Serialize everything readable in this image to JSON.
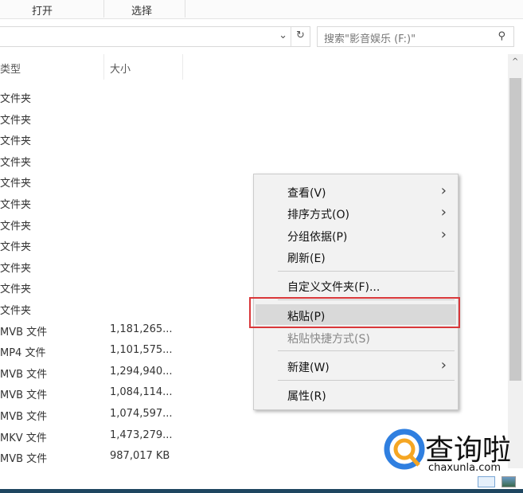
{
  "ribbon": {
    "tabs": [
      "打开",
      "选择"
    ]
  },
  "search": {
    "placeholder": "搜索\"影音娱乐 (F:)\""
  },
  "columns": {
    "type": "类型",
    "size": "大小"
  },
  "rows": [
    {
      "type": "文件夹",
      "size": ""
    },
    {
      "type": "文件夹",
      "size": ""
    },
    {
      "type": "文件夹",
      "size": ""
    },
    {
      "type": "文件夹",
      "size": ""
    },
    {
      "type": "文件夹",
      "size": ""
    },
    {
      "type": "文件夹",
      "size": ""
    },
    {
      "type": "文件夹",
      "size": ""
    },
    {
      "type": "文件夹",
      "size": ""
    },
    {
      "type": "文件夹",
      "size": ""
    },
    {
      "type": "文件夹",
      "size": ""
    },
    {
      "type": "文件夹",
      "size": ""
    },
    {
      "type": "MVB 文件",
      "size": "1,181,265..."
    },
    {
      "type": "MP4 文件",
      "size": "1,101,575..."
    },
    {
      "type": "MVB 文件",
      "size": "1,294,940..."
    },
    {
      "type": "MVB 文件",
      "size": "1,084,114..."
    },
    {
      "type": "MVB 文件",
      "size": "1,074,597..."
    },
    {
      "type": "MKV 文件",
      "size": "1,473,279..."
    },
    {
      "type": "MVB 文件",
      "size": "987,017 KB"
    }
  ],
  "menu": {
    "items": [
      {
        "label": "查看(V)",
        "submenu": true
      },
      {
        "label": "排序方式(O)",
        "submenu": true
      },
      {
        "label": "分组依据(P)",
        "submenu": true
      },
      {
        "label": "刷新(E)"
      },
      {
        "label": "自定义文件夹(F)..."
      },
      {
        "label": "粘贴(P)",
        "highlighted": true
      },
      {
        "label": "粘贴快捷方式(S)",
        "disabled": true
      },
      {
        "label": "新建(W)",
        "submenu": true
      },
      {
        "label": "属性(R)"
      }
    ]
  },
  "watermark": {
    "brand": "查询啦",
    "domain": "chaxunla.com"
  },
  "colors": {
    "highlight": "#d9373a",
    "logo_blue": "#2f7fe0",
    "logo_orange": "#f5a623"
  }
}
